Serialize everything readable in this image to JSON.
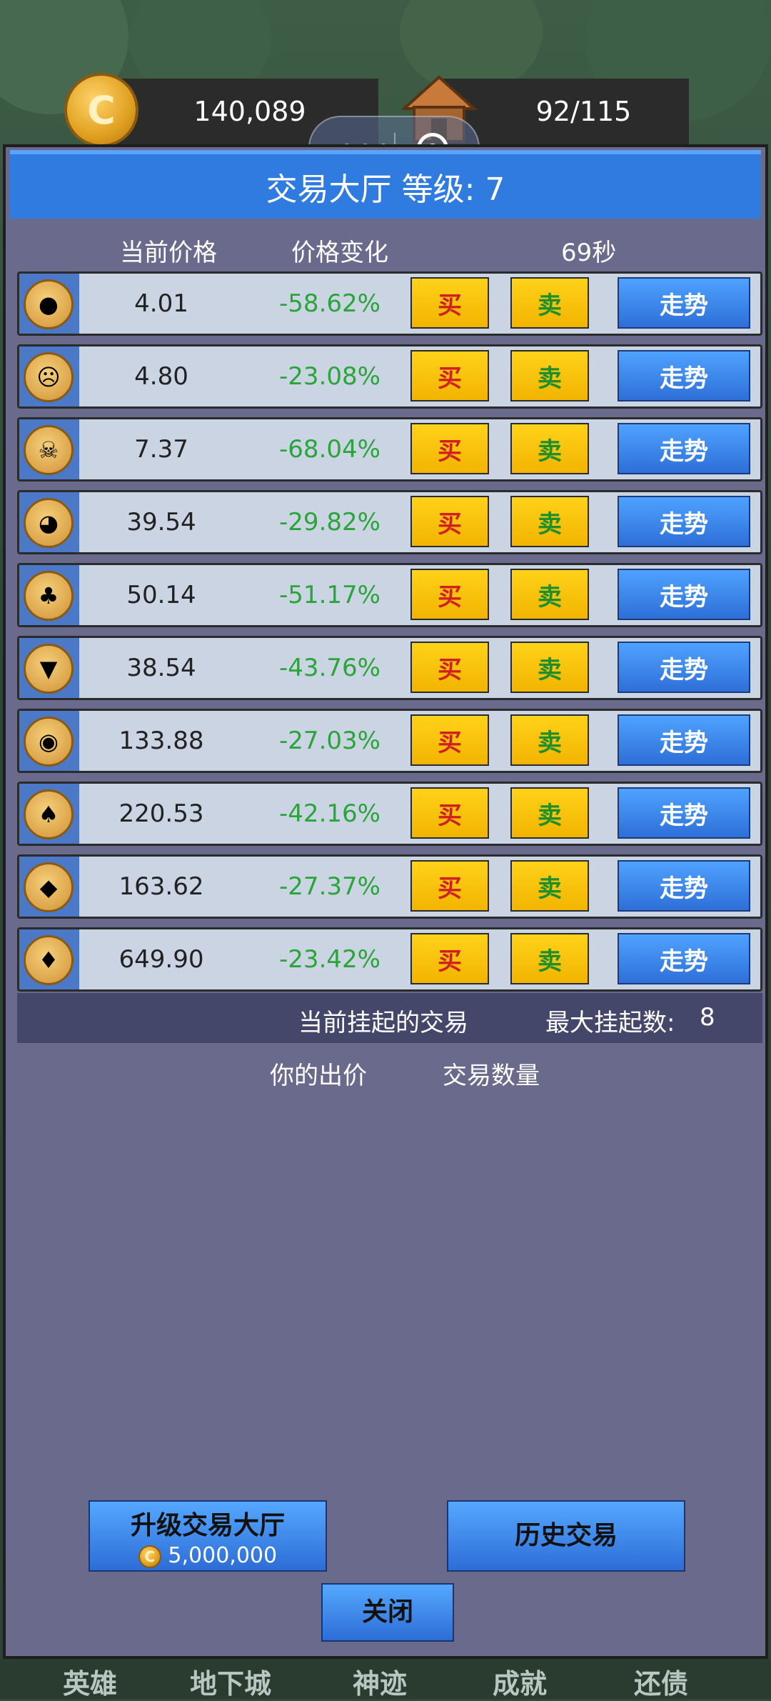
{
  "colors": {
    "panel": "#6a6b8c",
    "title_bar": "#2f7be0",
    "buy_text": "#d02020",
    "sell_text": "#1e8f2a",
    "change_green": "#2aa53a",
    "trend_btn": "#2e6fd8"
  },
  "resources": {
    "gold": "140,089",
    "capacity": "92/115"
  },
  "capsule": {
    "menu_icon": "more-dots-icon",
    "close_icon": "target-icon"
  },
  "panel": {
    "title": "交易大厅 等级: 7",
    "col_price": "当前价格",
    "col_change": "价格变化",
    "timer": "69秒"
  },
  "labels": {
    "buy": "买",
    "sell": "卖",
    "trend": "走势"
  },
  "rows": [
    {
      "icon": "slime-icon",
      "price": "4.01",
      "change": "-58.62%"
    },
    {
      "icon": "zombie-icon",
      "price": "4.80",
      "change": "-23.08%"
    },
    {
      "icon": "skull-icon",
      "price": "7.37",
      "change": "-68.04%"
    },
    {
      "icon": "goblin-icon",
      "price": "39.54",
      "change": "-29.82%"
    },
    {
      "icon": "treant-icon",
      "price": "50.14",
      "change": "-51.17%"
    },
    {
      "icon": "wolf-icon",
      "price": "38.54",
      "change": "-43.76%"
    },
    {
      "icon": "orc-icon",
      "price": "133.88",
      "change": "-27.03%"
    },
    {
      "icon": "mushroom-icon",
      "price": "220.53",
      "change": "-42.16%"
    },
    {
      "icon": "bat-icon",
      "price": "163.62",
      "change": "-27.37%"
    },
    {
      "icon": "dragon-icon",
      "price": "649.90",
      "change": "-23.42%"
    }
  ],
  "pending": {
    "title": "当前挂起的交易",
    "max_label": "最大挂起数:",
    "max_value": "8",
    "col_bid": "你的出价",
    "col_qty": "交易数量"
  },
  "buttons": {
    "upgrade": "升级交易大厅",
    "upgrade_cost": "5,000,000",
    "history": "历史交易",
    "close": "关闭"
  },
  "nav": [
    "英雄",
    "地下城",
    "神迹",
    "成就",
    "还债"
  ]
}
